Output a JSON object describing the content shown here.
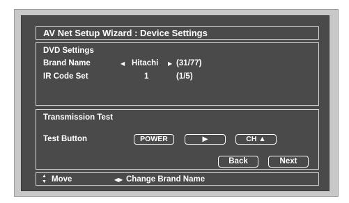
{
  "wizard": {
    "title": "AV Net Setup Wizard : Device Settings"
  },
  "dvd_settings": {
    "heading": "DVD Settings",
    "brand_label": "Brand Name",
    "brand_value": "Hitachi",
    "brand_index": "(31/77)",
    "ir_label": "IR Code Set",
    "ir_value": "1",
    "ir_index": "(1/5)"
  },
  "transmission_test": {
    "heading": "Transmission Test",
    "test_label": "Test Button",
    "power_label": "POWER",
    "play_label": "▶",
    "ch_label": "CH ▲"
  },
  "navigation": {
    "back_label": "Back",
    "next_label": "Next"
  },
  "help_bar": {
    "move_icon": "▲▼",
    "move_label": "Move",
    "change_icon": "◀▶",
    "change_label": "Change Brand Name"
  }
}
